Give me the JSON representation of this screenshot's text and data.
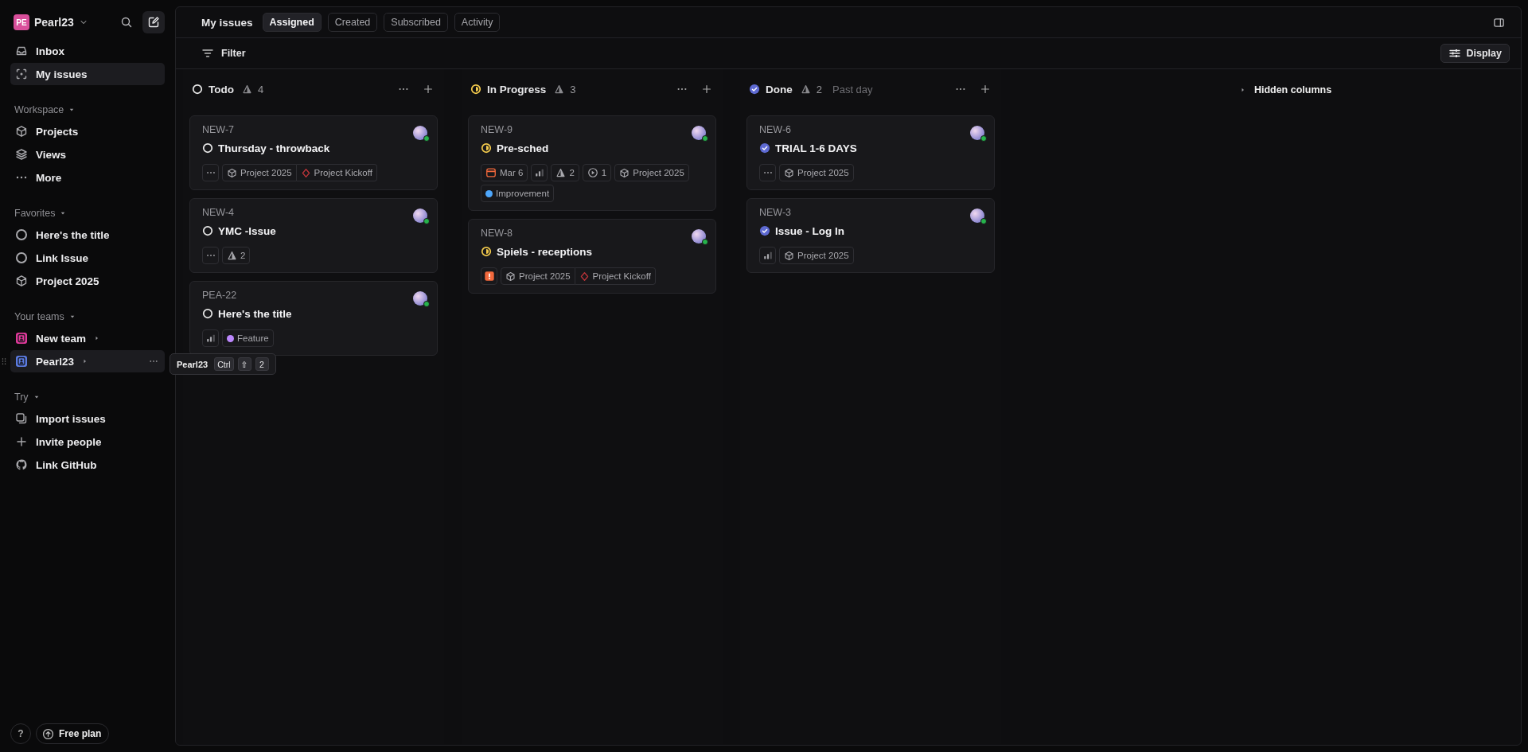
{
  "sidebar": {
    "workspace": {
      "initials": "PE",
      "name": "Pearl23"
    },
    "nav": [
      {
        "label": "Inbox",
        "kind": "inbox",
        "selected": false
      },
      {
        "label": "My issues",
        "kind": "focus",
        "selected": true
      }
    ],
    "sections": [
      {
        "title": "Workspace",
        "items": [
          {
            "label": "Projects",
            "kind": "cube",
            "hovered": false
          },
          {
            "label": "Views",
            "kind": "layers",
            "hovered": false
          },
          {
            "label": "More",
            "kind": "dots",
            "hovered": false
          }
        ]
      },
      {
        "title": "Favorites",
        "items": [
          {
            "label": "Here's the title",
            "kind": "circle",
            "hovered": false
          },
          {
            "label": "Link Issue",
            "kind": "circle",
            "hovered": false
          },
          {
            "label": "Project 2025",
            "kind": "cube",
            "hovered": false
          }
        ]
      },
      {
        "title": "Your teams",
        "items": [
          {
            "label": "New team",
            "kind": "team",
            "color": "#e0399a",
            "hovered": false
          },
          {
            "label": "Pearl23",
            "kind": "team",
            "color": "#5b7be0",
            "hovered": true
          }
        ]
      },
      {
        "title": "Try",
        "items": [
          {
            "label": "Import issues",
            "kind": "import",
            "hovered": false
          },
          {
            "label": "Invite people",
            "kind": "plus",
            "hovered": false
          },
          {
            "label": "Link GitHub",
            "kind": "github",
            "hovered": false
          }
        ]
      }
    ],
    "help": "?",
    "plan": "Free plan"
  },
  "tooltip": {
    "label": "Pearl23",
    "keys": [
      "Ctrl",
      "⇧",
      "2"
    ]
  },
  "header": {
    "title": "My issues",
    "tabs": [
      {
        "label": "Assigned",
        "selected": true
      },
      {
        "label": "Created",
        "selected": false
      },
      {
        "label": "Subscribed",
        "selected": false
      },
      {
        "label": "Activity",
        "selected": false
      }
    ]
  },
  "toolbar": {
    "filter": "Filter",
    "display": "Display"
  },
  "columns": [
    {
      "kind": "todo",
      "name": "Todo",
      "count": "4",
      "cards": [
        {
          "id": "NEW-7",
          "title": "Thursday - throwback",
          "kind": "todo",
          "chips": [
            {
              "kind": "no-priority"
            },
            {
              "kind": "project",
              "label": "Project 2025",
              "milestone": "Project Kickoff"
            }
          ]
        },
        {
          "id": "NEW-4",
          "title": "YMC -Issue",
          "kind": "todo",
          "chips": [
            {
              "kind": "no-priority"
            },
            {
              "kind": "estimate",
              "label": "2"
            }
          ]
        },
        {
          "id": "PEA-22",
          "title": "Here's the title",
          "kind": "todo",
          "chips": [
            {
              "kind": "priority"
            },
            {
              "kind": "label",
              "label": "Feature",
              "color": "#bb87fc"
            }
          ]
        }
      ]
    },
    {
      "kind": "progress",
      "name": "In Progress",
      "count": "3",
      "cards": [
        {
          "id": "NEW-9",
          "title": "Pre-sched",
          "kind": "progress",
          "chips": [
            {
              "kind": "due",
              "label": "Mar 6"
            },
            {
              "kind": "priority"
            },
            {
              "kind": "estimate",
              "label": "2"
            },
            {
              "kind": "cycle",
              "label": "1"
            },
            {
              "kind": "project",
              "label": "Project 2025"
            },
            {
              "kind": "label",
              "label": "Improvement",
              "color": "#4ea7fc"
            }
          ]
        },
        {
          "id": "NEW-8",
          "title": "Spiels - receptions",
          "kind": "progress",
          "chips": [
            {
              "kind": "urgent"
            },
            {
              "kind": "project",
              "label": "Project 2025",
              "milestone": "Project Kickoff"
            }
          ]
        }
      ]
    },
    {
      "kind": "done",
      "name": "Done",
      "count": "2",
      "note": "Past day",
      "cards": [
        {
          "id": "NEW-6",
          "title": "TRIAL 1-6 DAYS",
          "kind": "done",
          "chips": [
            {
              "kind": "no-priority"
            },
            {
              "kind": "project",
              "label": "Project 2025"
            }
          ]
        },
        {
          "id": "NEW-3",
          "title": "Issue - Log In",
          "kind": "done",
          "chips": [
            {
              "kind": "priority"
            },
            {
              "kind": "project",
              "label": "Project 2025"
            }
          ]
        }
      ]
    }
  ],
  "hidden_columns": "Hidden columns"
}
